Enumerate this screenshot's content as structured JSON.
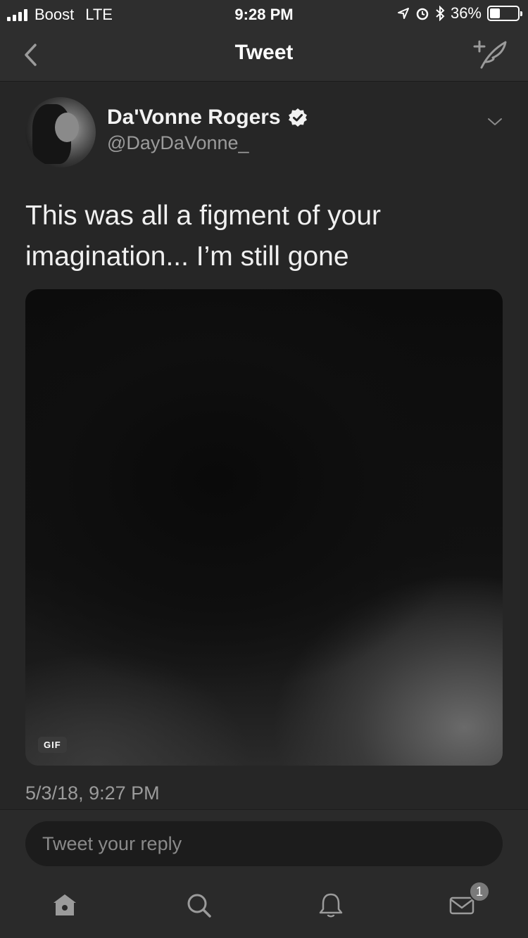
{
  "status_bar": {
    "carrier": "Boost",
    "network": "LTE",
    "time": "9:28 PM",
    "battery_percent": "36%",
    "battery_level": 0.36,
    "icons": [
      "location-arrow-icon",
      "alarm-icon",
      "bluetooth-icon"
    ]
  },
  "nav": {
    "title": "Tweet",
    "back_icon": "chevron-left-icon",
    "compose_icon": "compose-quill-icon"
  },
  "tweet": {
    "author_name": "Da'Vonne Rogers",
    "author_handle": "@DayDaVonne_",
    "verified": true,
    "text": "This was all a figment of your imagination... I’m still gone",
    "media_badge": "GIF",
    "timestamp": "5/3/18, 9:27 PM"
  },
  "reply": {
    "placeholder": "Tweet your reply"
  },
  "tabs": [
    {
      "name": "home",
      "icon": "home-icon"
    },
    {
      "name": "search",
      "icon": "search-icon"
    },
    {
      "name": "notifications",
      "icon": "bell-icon"
    },
    {
      "name": "messages",
      "icon": "envelope-icon",
      "badge": "1"
    }
  ],
  "colors": {
    "background": "#262626",
    "bar": "#2e2e2e",
    "text_primary": "#f0f0f0",
    "text_secondary": "#9b9b9b"
  }
}
